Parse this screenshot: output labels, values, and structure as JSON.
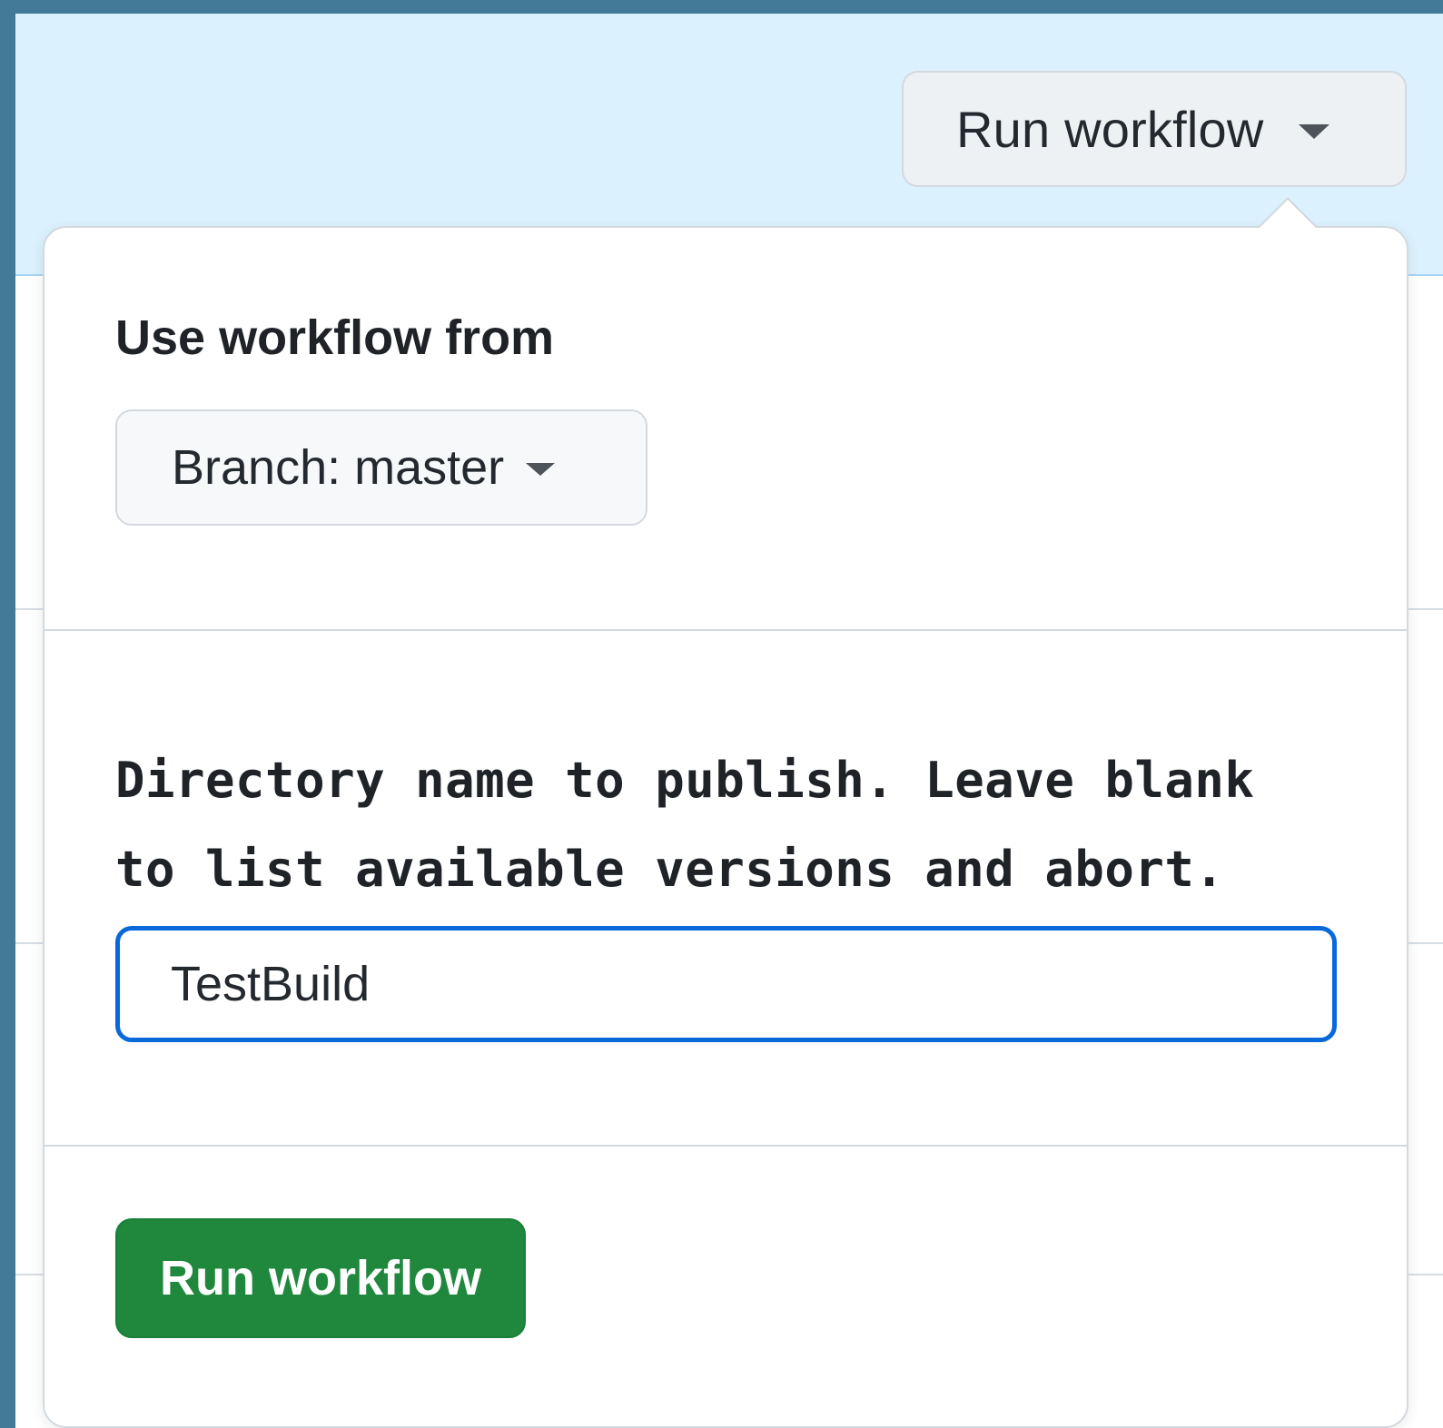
{
  "header": {
    "run_workflow_label": "Run workflow"
  },
  "popover": {
    "use_workflow_from_label": "Use workflow from",
    "branch_button_label": "Branch: master",
    "directory_input": {
      "label": "Directory name to publish. Leave blank to list available versions and abort.",
      "value": "TestBuild",
      "placeholder": ""
    },
    "submit_label": "Run workflow"
  },
  "colors": {
    "accent_focus": "#0969da",
    "primary_button": "#1f883d",
    "banner_bg": "#dbf1fd",
    "window_frame": "#427a97"
  }
}
